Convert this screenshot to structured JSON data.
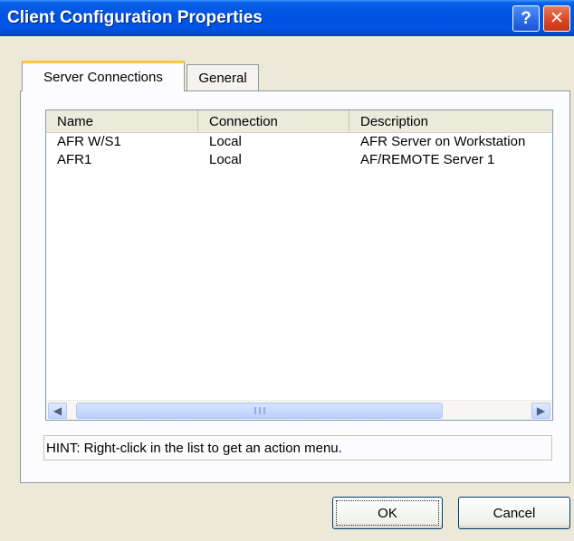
{
  "window": {
    "title": "Client Configuration Properties",
    "help_glyph": "?",
    "close_glyph": "✕"
  },
  "tabs": [
    {
      "label": "Server Connections",
      "active": true
    },
    {
      "label": "General",
      "active": false
    }
  ],
  "list": {
    "columns": [
      "Name",
      "Connection",
      "Description"
    ],
    "rows": [
      {
        "name": "AFR W/S1",
        "connection": "Local",
        "description": "AFR Server on Workstation"
      },
      {
        "name": "AFR1",
        "connection": "Local",
        "description": "AF/REMOTE Server 1"
      }
    ],
    "scroll_left": "◀",
    "scroll_right": "▶"
  },
  "hint": "HINT: Right-click in the list to get an action menu.",
  "buttons": {
    "ok": "OK",
    "cancel": "Cancel"
  },
  "colors": {
    "titlebar": "#0054e3",
    "face": "#ece9d8",
    "active_tab_accent": "#ffc83c"
  }
}
